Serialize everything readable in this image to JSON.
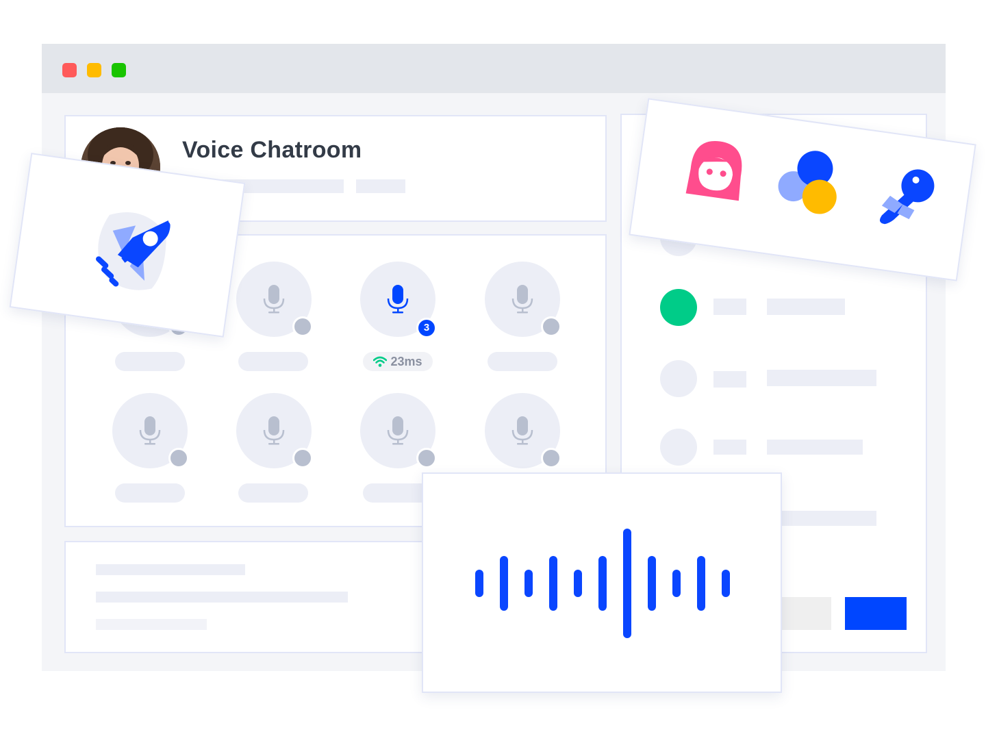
{
  "window": {
    "traffic_lights": [
      {
        "name": "close",
        "color": "#ff5a5a"
      },
      {
        "name": "minimize",
        "color": "#ffbb00"
      },
      {
        "name": "maximize",
        "color": "#19c400"
      }
    ]
  },
  "room": {
    "title": "Voice Chatroom"
  },
  "seats": {
    "active_count": "3",
    "latency": "23ms"
  },
  "colors": {
    "accent": "#0046ff",
    "online": "#00cc88",
    "placeholder": "#eceef6",
    "pink": "#ff4d8d",
    "yellow": "#ffbb00"
  },
  "icons": {
    "rocket": "rocket-icon",
    "avatar_face": "girl-face-icon",
    "circles": "overlapping-circles-icon",
    "karaoke": "karaoke-mic-icon",
    "mic": "microphone-icon",
    "wifi": "wifi-icon",
    "waveform": "audio-waveform-icon"
  }
}
